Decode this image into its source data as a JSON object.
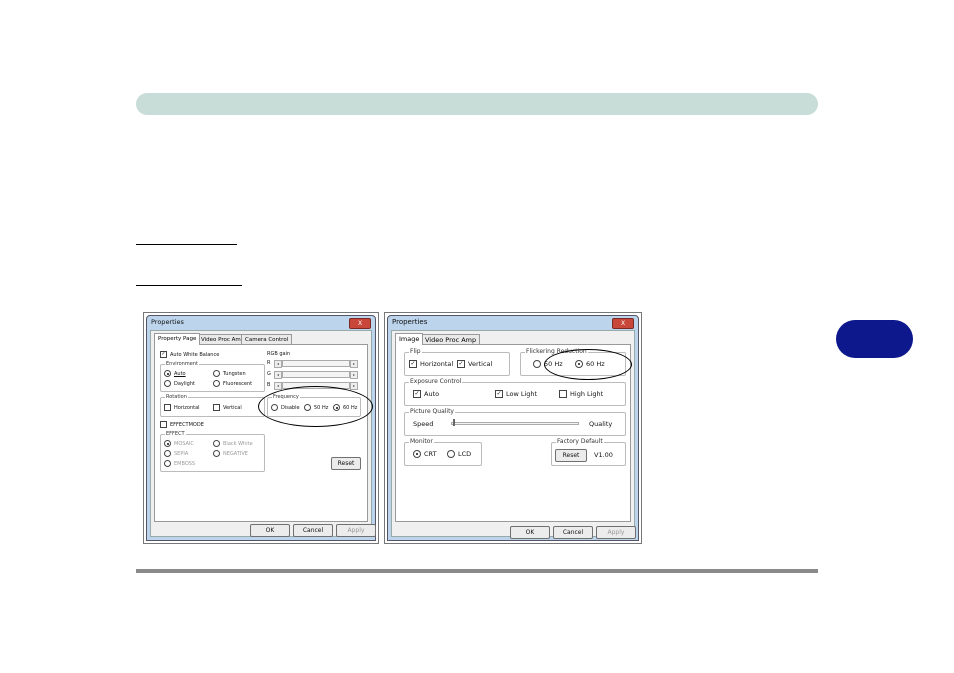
{
  "page": {
    "chapter_tab": "",
    "colors": {
      "header_bar": "#c8dcd8",
      "chapter_tab": "#0c188c",
      "footer_line": "#8a8a8a"
    }
  },
  "left_dialog": {
    "title": "Properties",
    "close_label": "X",
    "tabs": [
      "Property Page",
      "Video Proc Amp",
      "Camera Control"
    ],
    "auto_white_balance": "Auto White Balance",
    "environment": {
      "title": "Environment",
      "options": [
        "Auto",
        "Tungsten",
        "Daylight",
        "Fluorescent"
      ],
      "selected": "Auto"
    },
    "rgb_gain": {
      "title": "RGB gain",
      "channels": [
        "R",
        "G",
        "B"
      ]
    },
    "rotation": {
      "title": "Rotation",
      "options": [
        "Horizontal",
        "Vertical"
      ]
    },
    "frequency": {
      "title": "Frequency",
      "options": [
        "Disable",
        "50 Hz",
        "60 Hz"
      ],
      "selected": "60 Hz"
    },
    "effect_mode": "EFFECTMODE",
    "effect": {
      "title": "EFFECT",
      "options": [
        "MOSAIC",
        "Black White",
        "SEPIA",
        "NEGATIVE",
        "EMBOSS"
      ],
      "selected": "MOSAIC"
    },
    "reset": "Reset",
    "ok": "OK",
    "cancel": "Cancel",
    "apply": "Apply"
  },
  "right_dialog": {
    "title": "Properties",
    "close_label": "X",
    "tabs": [
      "Image",
      "Video Proc Amp"
    ],
    "flip": {
      "title": "Flip",
      "options": [
        "Horizontal",
        "Vertical"
      ]
    },
    "flicker": {
      "title": "Flickering Reduction",
      "options": [
        "50 Hz",
        "60 Hz"
      ],
      "selected": "60 Hz"
    },
    "exposure": {
      "title": "Exposure Control",
      "options": [
        "Auto",
        "Low Light",
        "High Light"
      ]
    },
    "picture_quality": {
      "title": "Picture Quality",
      "left": "Speed",
      "right": "Quality",
      "level": 0.02
    },
    "monitor": {
      "title": "Monitor",
      "options": [
        "CRT",
        "LCD"
      ],
      "selected": "CRT"
    },
    "factory_default": {
      "title": "Factory Default",
      "reset": "Reset",
      "version": "V1.00"
    },
    "ok": "OK",
    "cancel": "Cancel",
    "apply": "Apply"
  }
}
